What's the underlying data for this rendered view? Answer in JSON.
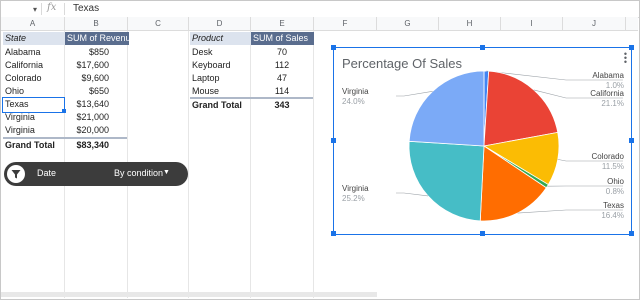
{
  "formula_bar": {
    "fx": "fx",
    "value": "Texas"
  },
  "columns": [
    "A",
    "B",
    "C",
    "D",
    "E",
    "F",
    "G",
    "H",
    "I",
    "J"
  ],
  "pivot1": {
    "headers": [
      "State",
      "SUM of Revenue"
    ],
    "rows": [
      [
        "Alabama",
        "$850"
      ],
      [
        "California",
        "$17,600"
      ],
      [
        "Colorado",
        "$9,600"
      ],
      [
        "Ohio",
        "$650"
      ],
      [
        "Texas",
        "$13,640"
      ],
      [
        "Virginia",
        "$21,000"
      ],
      [
        "Virginia",
        "$20,000"
      ]
    ],
    "total": [
      "Grand Total",
      "$83,340"
    ]
  },
  "pivot2": {
    "headers": [
      "Product",
      "SUM of Sales"
    ],
    "rows": [
      [
        "Desk",
        "70"
      ],
      [
        "Keyboard",
        "112"
      ],
      [
        "Laptop",
        "47"
      ],
      [
        "Mouse",
        "114"
      ]
    ],
    "total": [
      "Grand Total",
      "343"
    ]
  },
  "filter": {
    "label": "Date",
    "condition": "By condition"
  },
  "chart_data": {
    "type": "pie",
    "title": "Percentage Of Sales",
    "slices": [
      {
        "label": "Alabama",
        "value": 1.0,
        "pct": "1.0%",
        "color": "#4285f4"
      },
      {
        "label": "California",
        "value": 21.1,
        "pct": "21.1%",
        "color": "#ea4335"
      },
      {
        "label": "Colorado",
        "value": 11.5,
        "pct": "11.5%",
        "color": "#fbbc04"
      },
      {
        "label": "Ohio",
        "value": 0.8,
        "pct": "0.8%",
        "color": "#34a853"
      },
      {
        "label": "Texas",
        "value": 16.4,
        "pct": "16.4%",
        "color": "#ff6d01"
      },
      {
        "label": "Virginia",
        "value": 25.2,
        "pct": "25.2%",
        "color": "#46bdc6"
      },
      {
        "label": "Virginia",
        "value": 24.0,
        "pct": "24.0%",
        "color": "#7baaf7"
      }
    ]
  }
}
